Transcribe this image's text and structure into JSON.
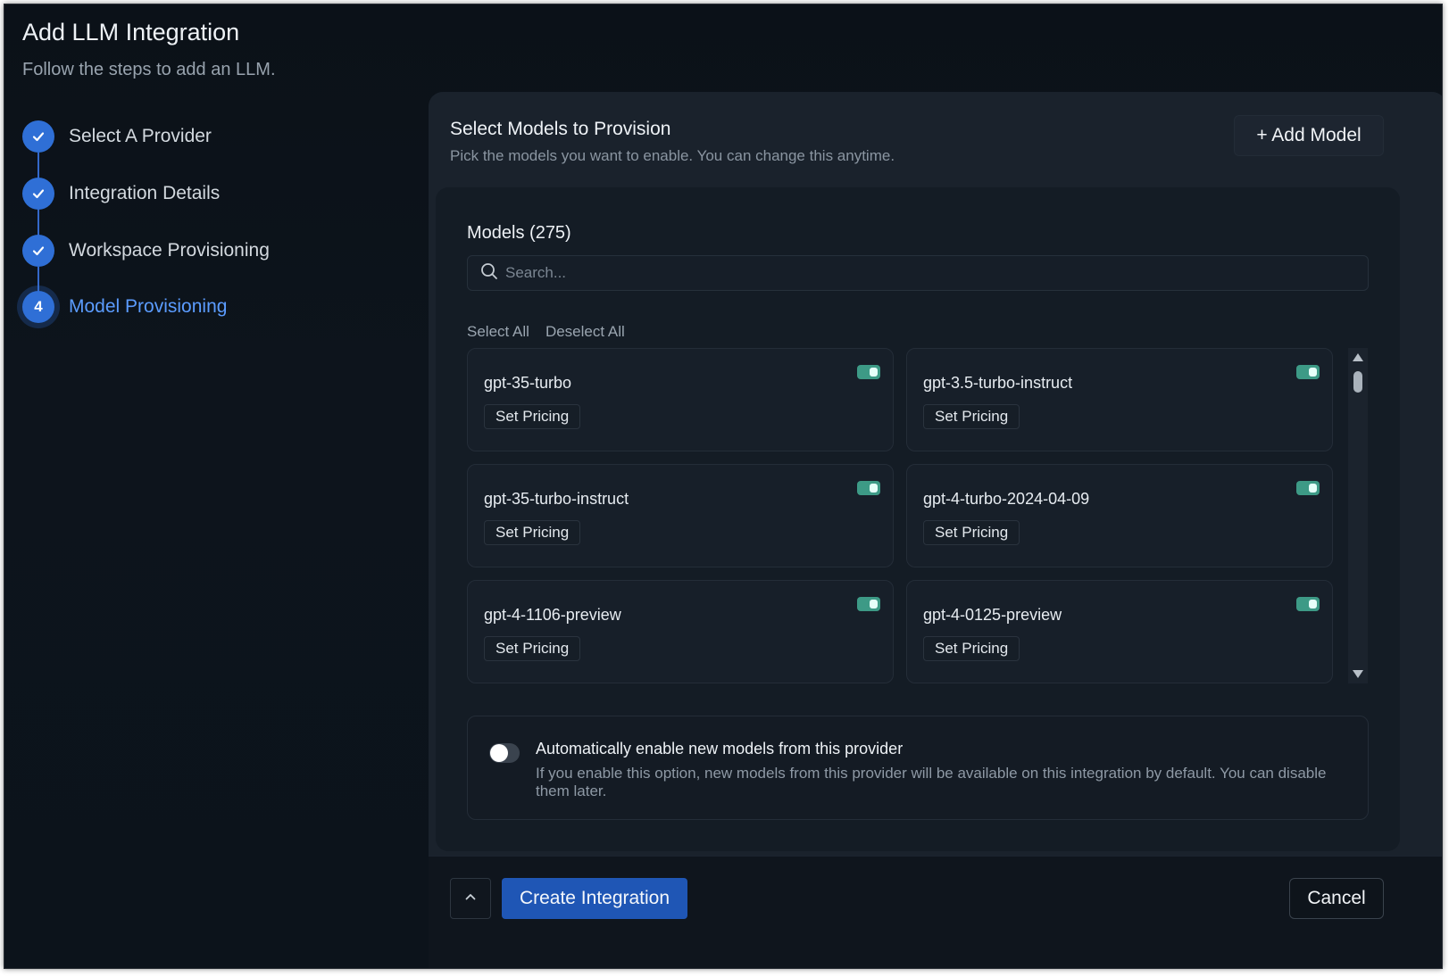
{
  "header": {
    "title": "Add LLM Integration",
    "subtitle": "Follow the steps to add an LLM."
  },
  "stepper": {
    "steps": [
      {
        "label": "Select A Provider",
        "status": "done"
      },
      {
        "label": "Integration Details",
        "status": "done"
      },
      {
        "label": "Workspace Provisioning",
        "status": "done"
      },
      {
        "label": "Model Provisioning",
        "status": "active",
        "number": "4"
      }
    ]
  },
  "panel": {
    "title": "Select Models to Provision",
    "subtitle": "Pick the models you want to enable. You can change this anytime.",
    "add_model_label": "+ Add Model"
  },
  "models": {
    "title": "Models (275)",
    "search_placeholder": "Search...",
    "select_all": "Select All",
    "deselect_all": "Deselect All",
    "items": [
      {
        "name": "gpt-35-turbo",
        "pricing_label": "Set Pricing",
        "enabled": true
      },
      {
        "name": "gpt-3.5-turbo-instruct",
        "pricing_label": "Set Pricing",
        "enabled": true
      },
      {
        "name": "gpt-35-turbo-instruct",
        "pricing_label": "Set Pricing",
        "enabled": true
      },
      {
        "name": "gpt-4-turbo-2024-04-09",
        "pricing_label": "Set Pricing",
        "enabled": true
      },
      {
        "name": "gpt-4-1106-preview",
        "pricing_label": "Set Pricing",
        "enabled": true
      },
      {
        "name": "gpt-4-0125-preview",
        "pricing_label": "Set Pricing",
        "enabled": true
      }
    ]
  },
  "auto_enable": {
    "title": "Automatically enable new models from this provider",
    "description": "If you enable this option, new models from this provider will be available on this integration by default. You can disable them later.",
    "enabled": false
  },
  "footer": {
    "create_label": "Create Integration",
    "cancel_label": "Cancel"
  },
  "colors": {
    "accent": "#2f6fd6",
    "toggle_on": "#3d9a86",
    "primary_button": "#1f56b5"
  }
}
